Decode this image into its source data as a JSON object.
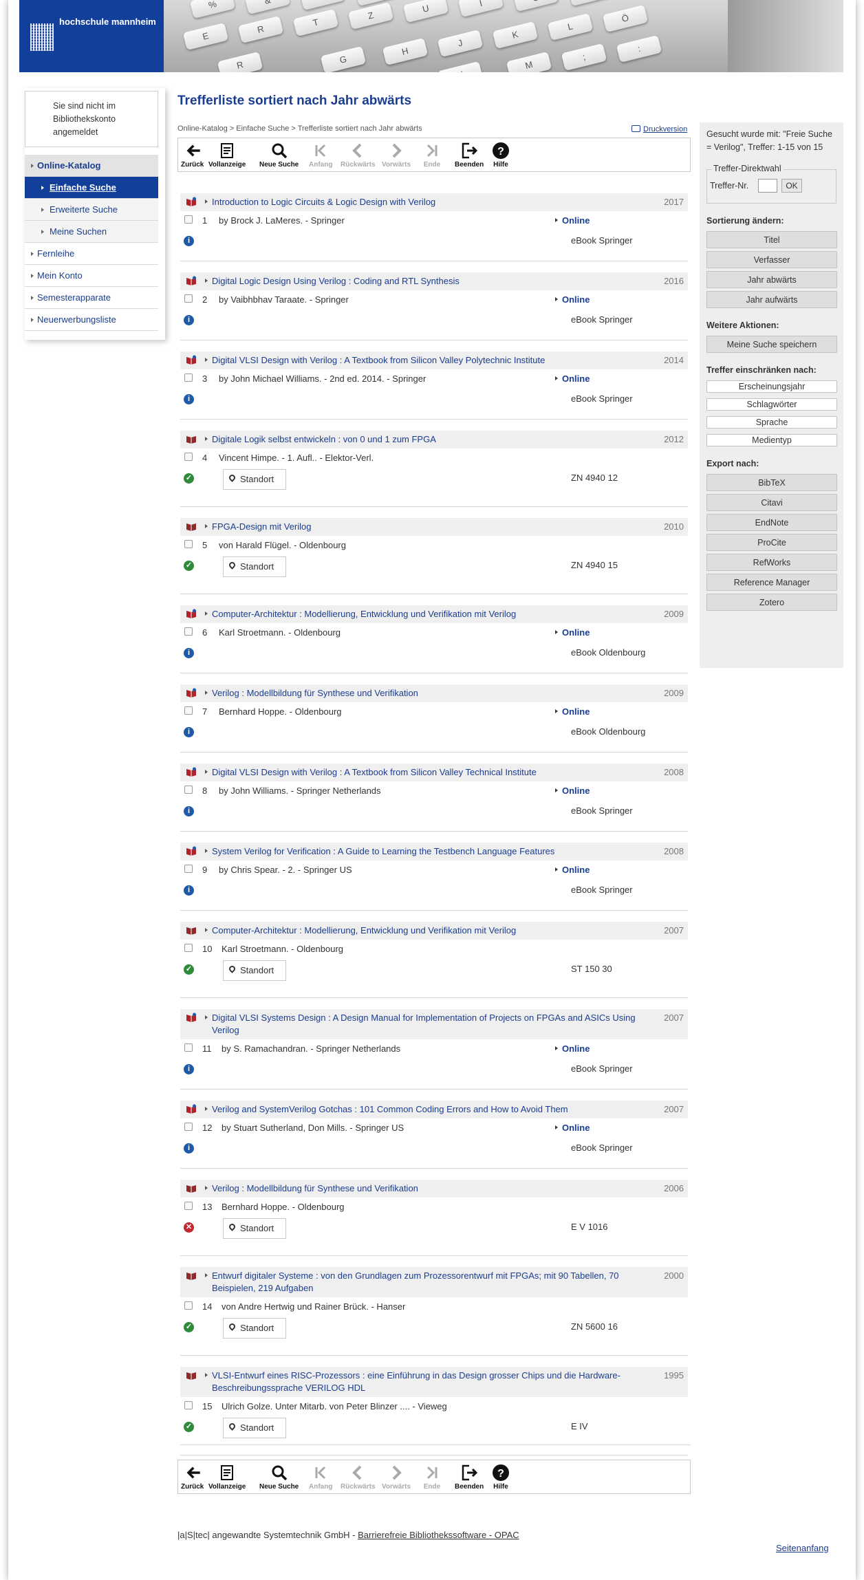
{
  "header": {
    "logo_text": "hochschule mannheim"
  },
  "sidebar": {
    "notice": "Sie sind nicht im Bibliothekskonto angemeldet",
    "nav": [
      {
        "label": "Online-Katalog",
        "type": "main"
      },
      {
        "label": "Einfache Suche",
        "type": "sub-active"
      },
      {
        "label": "Erweiterte Suche",
        "type": "sub"
      },
      {
        "label": "Meine Suchen",
        "type": "sub"
      },
      {
        "label": "Fernleihe",
        "type": "top"
      },
      {
        "label": "Mein Konto",
        "type": "top"
      },
      {
        "label": "Semesterapparate",
        "type": "top"
      },
      {
        "label": "Neuerwerbungsliste",
        "type": "top"
      }
    ]
  },
  "main": {
    "title": "Trefferliste sortiert nach Jahr abwärts",
    "breadcrumb": "Online-Katalog > Einfache Suche > Trefferliste sortiert nach Jahr abwärts",
    "print_label": "Druckversion"
  },
  "toolbar": {
    "buttons": [
      {
        "label": "Zurück",
        "icon": "arrow-left-icon",
        "enabled": true
      },
      {
        "label": "Vollanzeige",
        "icon": "document-icon",
        "enabled": true
      },
      {
        "label": "Neue Suche",
        "icon": "search-icon",
        "enabled": true
      },
      {
        "label": "Anfang",
        "icon": "first-page-icon",
        "enabled": false
      },
      {
        "label": "Rückwärts",
        "icon": "chevron-left-icon",
        "enabled": false
      },
      {
        "label": "Vorwärts",
        "icon": "chevron-right-icon",
        "enabled": false
      },
      {
        "label": "Ende",
        "icon": "last-page-icon",
        "enabled": false
      },
      {
        "label": "Beenden",
        "icon": "exit-icon",
        "enabled": true
      },
      {
        "label": "Hilfe",
        "icon": "help-icon",
        "enabled": true
      }
    ]
  },
  "results": [
    {
      "n": "1",
      "title": "Introduction to Logic Circuits & Logic Design with Verilog",
      "year": "2017",
      "author": "by Brock J. LaMeres. - Springer",
      "online": "Online",
      "status": "info",
      "location": "eBook Springer",
      "book": "ebook"
    },
    {
      "n": "2",
      "title": "Digital Logic Design Using Verilog : Coding and RTL Synthesis",
      "year": "2016",
      "author": "by Vaibhbhav Taraate. - Springer",
      "online": "Online",
      "status": "info",
      "location": "eBook Springer",
      "book": "ebook"
    },
    {
      "n": "3",
      "title": "Digital VLSI Design with Verilog : A Textbook from Silicon Valley Polytechnic Institute",
      "year": "2014",
      "author": "by John Michael Williams. - 2nd ed. 2014. - Springer",
      "online": "Online",
      "status": "info",
      "location": "eBook Springer",
      "book": "ebook"
    },
    {
      "n": "4",
      "title": "Digitale Logik selbst entwickeln : von 0 und 1 zum FPGA",
      "year": "2012",
      "author": "Vincent Himpe. - 1. Aufl.. - Elektor-Verl.",
      "status": "ok",
      "standort": "Standort",
      "location": "ZN 4940 12",
      "book": "print"
    },
    {
      "n": "5",
      "title": "FPGA-Design mit Verilog",
      "year": "2010",
      "author": "von Harald Flügel. - Oldenbourg",
      "status": "ok",
      "standort": "Standort",
      "location": "ZN 4940 15",
      "book": "print"
    },
    {
      "n": "6",
      "title": "Computer-Architektur : Modellierung, Entwicklung und Verifikation mit Verilog",
      "year": "2009",
      "author": "Karl Stroetmann. - Oldenbourg",
      "online": "Online",
      "status": "info",
      "location": "eBook Oldenbourg",
      "book": "ebook"
    },
    {
      "n": "7",
      "title": "Verilog : Modellbildung für Synthese und Verifikation",
      "year": "2009",
      "author": "Bernhard Hoppe. - Oldenbourg",
      "online": "Online",
      "status": "info",
      "location": "eBook Oldenbourg",
      "book": "ebook"
    },
    {
      "n": "8",
      "title": "Digital VLSI Design with Verilog : A Textbook from Silicon Valley Technical Institute",
      "year": "2008",
      "author": "by John Williams. - Springer Netherlands",
      "online": "Online",
      "status": "info",
      "location": "eBook Springer",
      "book": "ebook"
    },
    {
      "n": "9",
      "title": "System Verilog for Verification : A Guide to Learning the Testbench Language Features",
      "year": "2008",
      "author": "by Chris Spear. - 2. - Springer US",
      "online": "Online",
      "status": "info",
      "location": "eBook Springer",
      "book": "ebook"
    },
    {
      "n": "10",
      "title": "Computer-Architektur : Modellierung, Entwicklung und Verifikation mit Verilog",
      "year": "2007",
      "author": "Karl Stroetmann. - Oldenbourg",
      "status": "ok",
      "standort": "Standort",
      "location": "ST 150 30",
      "book": "print"
    },
    {
      "n": "11",
      "title": "Digital VLSI Systems Design : A Design Manual for Implementation of Projects on FPGAs and ASICs Using Verilog",
      "year": "2007",
      "author": "by S. Ramachandran. - Springer Netherlands",
      "online": "Online",
      "status": "info",
      "location": "eBook Springer",
      "book": "ebook"
    },
    {
      "n": "12",
      "title": "Verilog and SystemVerilog Gotchas : 101 Common Coding Errors and How to Avoid Them",
      "year": "2007",
      "author": "by Stuart Sutherland, Don Mills. - Springer US",
      "online": "Online",
      "status": "info",
      "location": "eBook Springer",
      "book": "ebook"
    },
    {
      "n": "13",
      "title": "Verilog : Modellbildung für Synthese und Verifikation",
      "year": "2006",
      "author": "Bernhard Hoppe. - Oldenbourg",
      "status": "no",
      "standort": "Standort",
      "location": "E V 1016",
      "book": "print"
    },
    {
      "n": "14",
      "title": "Entwurf digitaler Systeme : von den Grundlagen zum Prozessorentwurf mit FPGAs; mit 90 Tabellen, 70 Beispielen, 219 Aufgaben",
      "year": "2000",
      "author": "von Andre Hertwig und Rainer Brück. - Hanser",
      "status": "ok",
      "standort": "Standort",
      "location": "ZN 5600 16",
      "book": "print"
    },
    {
      "n": "15",
      "title": "VLSI-Entwurf eines RISC-Prozessors : eine Einführung in das Design grosser Chips und die Hardware-Beschreibungssprache VERILOG HDL",
      "year": "1995",
      "author": "Ulrich Golze. Unter Mitarb. von Peter Blinzer .... - Vieweg",
      "status": "ok",
      "standort": "Standort",
      "location": "E IV",
      "book": "print"
    }
  ],
  "right_panel": {
    "search_info": "Gesucht wurde mit: \"Freie Suche = Verilog\", Treffer: 1-15 von 15",
    "direct_legend": "Treffer-Direktwahl",
    "direct_label": "Treffer-Nr.",
    "direct_ok": "OK",
    "sort_heading": "Sortierung ändern:",
    "sort_buttons": [
      "Titel",
      "Verfasser",
      "Jahr abwärts",
      "Jahr aufwärts"
    ],
    "actions_heading": "Weitere Aktionen:",
    "save_search": "Meine Suche speichern",
    "filter_heading": "Treffer einschränken nach:",
    "filters": [
      "Erscheinungsjahr",
      "Schlagwörter",
      "Sprache",
      "Medientyp"
    ],
    "export_heading": "Export nach:",
    "exports": [
      "BibTeX",
      "Citavi",
      "EndNote",
      "ProCite",
      "RefWorks",
      "Reference Manager",
      "Zotero"
    ]
  },
  "footer": {
    "company": "|a|S|tec| angewandte Systemtechnik GmbH - ",
    "link": "Barrierefreie Bibliothekssoftware - OPAC",
    "top_link": "Seitenanfang"
  },
  "colors": {
    "brand_blue": "#123f9a",
    "link_blue": "#1b3d8f",
    "ok_green": "#2f8a3a",
    "error_red": "#c0292f",
    "info_blue": "#1e5aa8"
  }
}
